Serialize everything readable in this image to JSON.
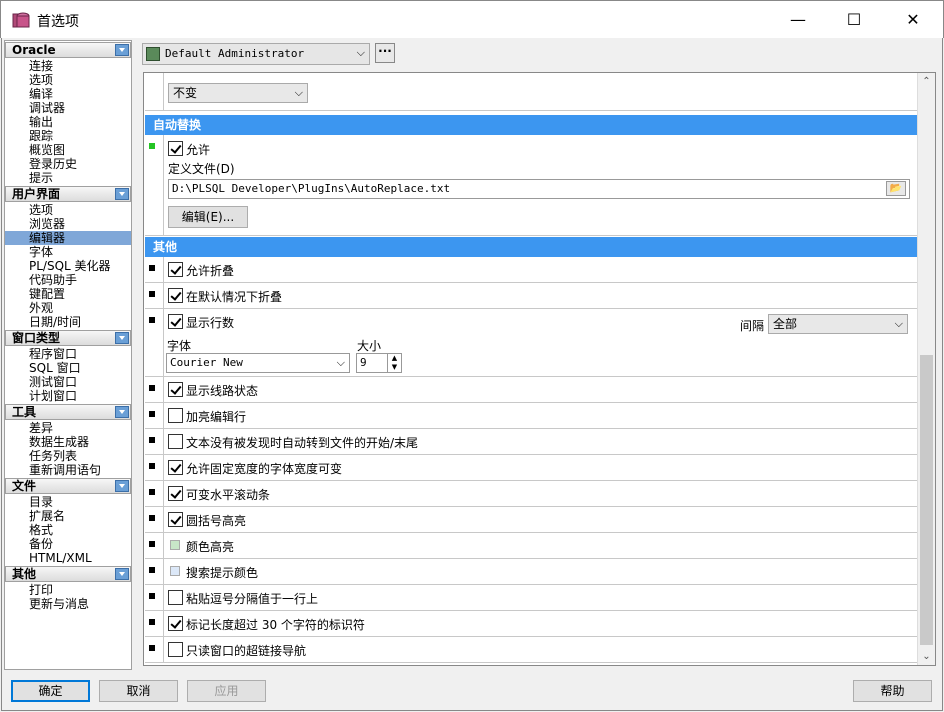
{
  "window": {
    "title": "首选项",
    "minimize": "—",
    "maximize": "☐",
    "close": "✕"
  },
  "nav": {
    "groups": [
      {
        "header": "Oracle",
        "items": [
          "连接",
          "选项",
          "编译",
          "调试器",
          "输出",
          "跟踪",
          "概览图",
          "登录历史",
          "提示"
        ]
      },
      {
        "header": "用户界面",
        "items": [
          "选项",
          "浏览器",
          "编辑器",
          "字体",
          "PL/SQL 美化器",
          "代码助手",
          "键配置",
          "外观",
          "日期/时间"
        ]
      },
      {
        "header": "窗口类型",
        "items": [
          "程序窗口",
          "SQL 窗口",
          "测试窗口",
          "计划窗口"
        ]
      },
      {
        "header": "工具",
        "items": [
          "差异",
          "数据生成器",
          "任务列表",
          "重新调用语句"
        ]
      },
      {
        "header": "文件",
        "items": [
          "目录",
          "扩展名",
          "格式",
          "备份",
          "HTML/XML"
        ]
      },
      {
        "header": "其他",
        "items": [
          "打印",
          "更新与消息"
        ]
      }
    ],
    "selected": "编辑器"
  },
  "profile": {
    "value": "Default Administrator",
    "more_button": "···"
  },
  "top_combo": {
    "value": "不变"
  },
  "autoreplace": {
    "header": "自动替换",
    "allow_label": "允许",
    "allow_checked": true,
    "def_file_label": "定义文件(D)",
    "def_file_value": "D:\\PLSQL Developer\\PlugIns\\AutoReplace.txt",
    "edit_button": "编辑(E)..."
  },
  "other": {
    "header": "其他",
    "options": [
      {
        "label": "允许折叠",
        "checked": true
      },
      {
        "label": "在默认情况下折叠",
        "checked": true
      },
      {
        "label": "显示行数",
        "checked": true
      },
      {
        "label": "显示线路状态",
        "checked": true
      },
      {
        "label": "加亮编辑行",
        "checked": false
      },
      {
        "label": "文本没有被发现时自动转到文件的开始/末尾",
        "checked": false
      },
      {
        "label": "允许固定宽度的字体宽度可变",
        "checked": true
      },
      {
        "label": "可变水平滚动条",
        "checked": true
      },
      {
        "label": "圆括号高亮",
        "checked": true
      },
      {
        "label": "颜色高亮",
        "swatch": "#c8e6c8"
      },
      {
        "label": "搜索提示颜色",
        "swatch": "#dce8f8"
      },
      {
        "label": "粘贴逗号分隔值于一行上",
        "checked": false
      },
      {
        "label": "标记长度超过 30 个字符的标识符",
        "checked": true
      },
      {
        "label": "只读窗口的超链接导航",
        "checked": false
      }
    ],
    "line_numbers": {
      "interval_label": "间隔",
      "interval_value": "全部",
      "font_label": "字体",
      "font_value": "Courier New",
      "size_label": "大小",
      "size_value": "9"
    }
  },
  "buttons": {
    "ok": "确定",
    "cancel": "取消",
    "apply": "应用",
    "help": "帮助"
  },
  "colors": {
    "section_header": "#3c96f0",
    "nav_selected": "#7fa7d8"
  }
}
